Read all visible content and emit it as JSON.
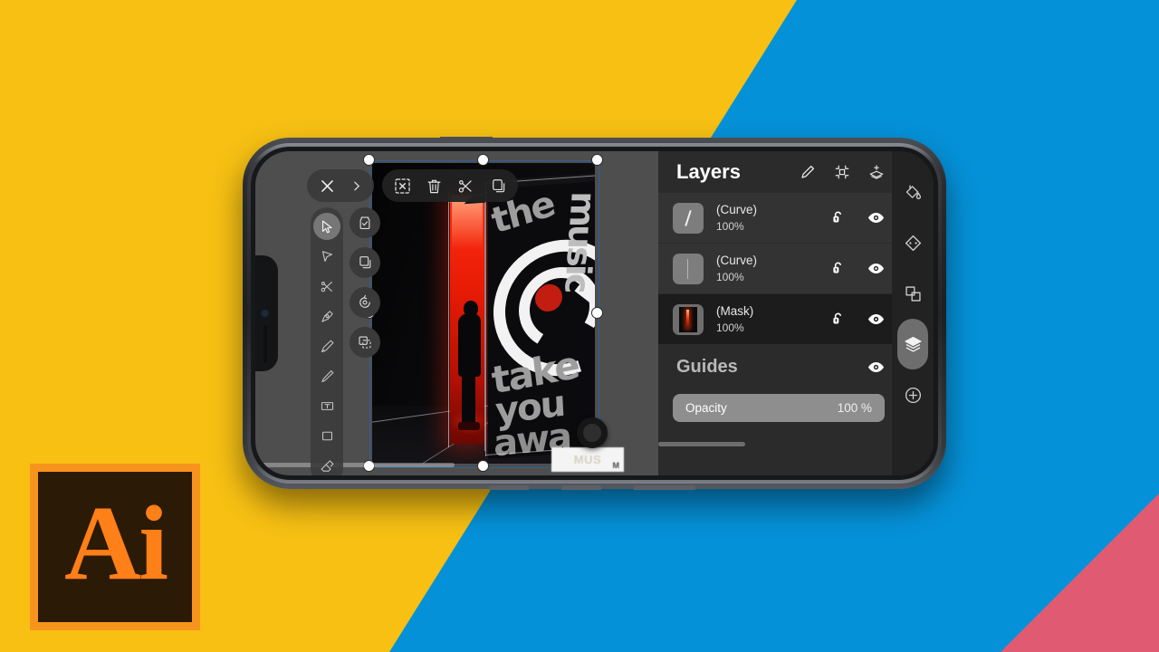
{
  "background": {
    "yellow": "#F7C013",
    "blue": "#0591D8",
    "pink": "#E05A72"
  },
  "logo": {
    "name": "adobe-illustrator-logo",
    "text": "Ai",
    "border_color": "#F7941E",
    "fill_color": "#2B1A06",
    "text_color": "#FF7F18"
  },
  "toolbar": {
    "close_label": "close-icon",
    "expand_label": "chevron-right-icon",
    "items": [
      {
        "name": "deselect-icon",
        "label": "Deselect"
      },
      {
        "name": "trash-icon",
        "label": "Delete"
      },
      {
        "name": "scissors-icon",
        "label": "Cut"
      },
      {
        "name": "duplicate-icon",
        "label": "Duplicate"
      }
    ]
  },
  "tools": [
    {
      "name": "move-tool",
      "label": "Move",
      "active": true
    },
    {
      "name": "node-select-tool",
      "label": "Node"
    },
    {
      "name": "scissors-tool",
      "label": "Scissors"
    },
    {
      "name": "pen-tool",
      "label": "Pen"
    },
    {
      "name": "pencil-tool",
      "label": "Pencil"
    },
    {
      "name": "brush-tool",
      "label": "Brush"
    },
    {
      "name": "text-tool",
      "label": "Text"
    },
    {
      "name": "rectangle-tool",
      "label": "Rectangle"
    },
    {
      "name": "eraser-tool",
      "label": "Eraser"
    }
  ],
  "actions": [
    {
      "name": "select-jar-action",
      "label": "Select All"
    },
    {
      "name": "copy-action",
      "label": "Copy"
    },
    {
      "name": "undo-action",
      "label": "Undo"
    },
    {
      "name": "transform-action",
      "label": "Transform"
    }
  ],
  "panel": {
    "title": "Layers",
    "header_icons": [
      {
        "name": "edit-pencil-icon",
        "label": "Edit"
      },
      {
        "name": "crop-frame-icon",
        "label": "Crop"
      },
      {
        "name": "add-layer-icon",
        "label": "Add Layer"
      }
    ],
    "layers": [
      {
        "name": "(Curve)",
        "opacity": "100%",
        "locked": false,
        "visible": true,
        "selected": false,
        "thumb": "curve-stroke"
      },
      {
        "name": "(Curve)",
        "opacity": "100%",
        "locked": false,
        "visible": true,
        "selected": false,
        "thumb": "curve-faint"
      },
      {
        "name": "(Mask)",
        "opacity": "100%",
        "locked": false,
        "visible": true,
        "selected": true,
        "thumb": "mask-image"
      }
    ],
    "guides": {
      "title": "Guides",
      "visible": true
    },
    "opacity": {
      "label": "Opacity",
      "value": "100 %"
    }
  },
  "rail": [
    {
      "name": "fill-paint-icon",
      "label": "Fill",
      "active": false
    },
    {
      "name": "node-diamond-icon",
      "label": "Nodes",
      "active": false
    },
    {
      "name": "shapes-overlap-icon",
      "label": "Shapes",
      "active": false
    },
    {
      "name": "layers-stack-icon",
      "label": "Layers",
      "active": true
    },
    {
      "name": "add-plus-icon",
      "label": "Add",
      "active": false
    }
  ],
  "artwork": {
    "name": "music-box-artwork",
    "words": {
      "the": "the",
      "music": "music",
      "take": "take",
      "you": "you",
      "away": "awa"
    },
    "card_text": "MUS",
    "card_mark": "M"
  }
}
